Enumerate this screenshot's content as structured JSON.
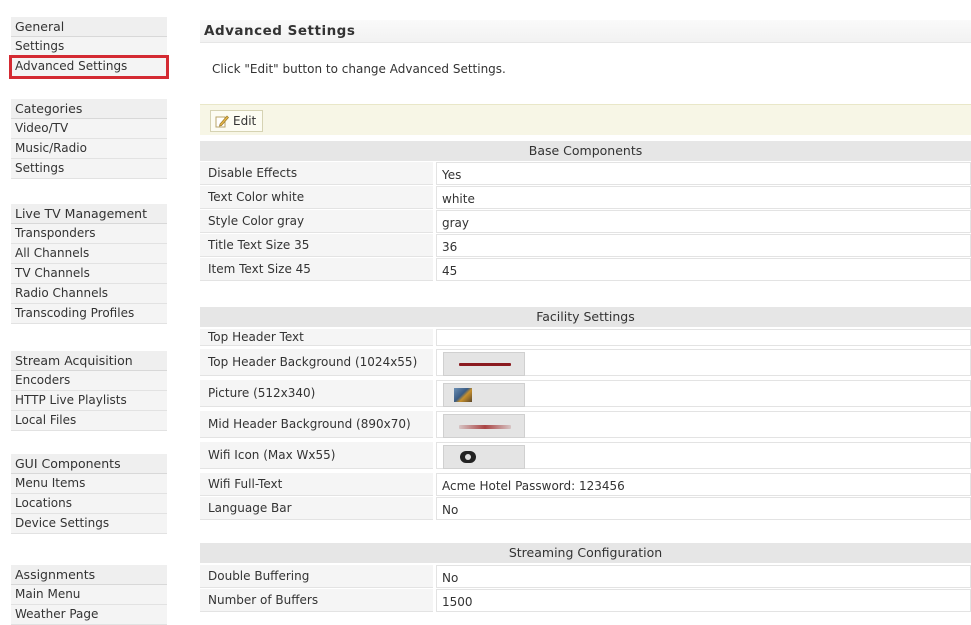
{
  "sidebar": {
    "groups": [
      {
        "title": "General",
        "items": [
          "Settings",
          "Advanced Settings"
        ]
      },
      {
        "title": "Categories",
        "items": [
          "Video/TV",
          "Music/Radio",
          "Settings"
        ]
      },
      {
        "title": "Live TV Management",
        "items": [
          "Transponders",
          "All Channels",
          "TV Channels",
          "Radio Channels",
          "Transcoding Profiles"
        ]
      },
      {
        "title": "Stream Acquisition",
        "items": [
          "Encoders",
          "HTTP Live Playlists",
          "Local Files"
        ]
      },
      {
        "title": "GUI Components",
        "items": [
          "Menu Items",
          "Locations",
          "Device Settings"
        ]
      },
      {
        "title": "Assignments",
        "items": [
          "Main Menu",
          "Weather Page"
        ]
      }
    ],
    "active_item": "Advanced Settings"
  },
  "main": {
    "title": "Advanced Settings",
    "intro": "Click \"Edit\" button to change Advanced Settings.",
    "edit_label": "Edit",
    "sections": {
      "base": {
        "title": "Base Components",
        "rows": [
          {
            "label": "Disable Effects",
            "value": "Yes"
          },
          {
            "label": "Text Color white",
            "value": "white"
          },
          {
            "label": "Style Color gray",
            "value": "gray"
          },
          {
            "label": "Title Text Size 35",
            "value": "36"
          },
          {
            "label": "Item Text Size 45",
            "value": "45"
          }
        ]
      },
      "facility": {
        "title": "Facility Settings",
        "rows": [
          {
            "label": "Top Header Text",
            "value": ""
          },
          {
            "label": "Top Header Background (1024x55)",
            "value": ""
          },
          {
            "label": "Picture (512x340)",
            "value": ""
          },
          {
            "label": "Mid Header Background (890x70)",
            "value": ""
          },
          {
            "label": "Wifi Icon (Max Wx55)",
            "value": ""
          },
          {
            "label": "Wifi Full-Text",
            "value": "Acme Hotel Password: 123456"
          },
          {
            "label": "Language Bar",
            "value": "No"
          }
        ]
      },
      "streaming": {
        "title": "Streaming Configuration",
        "rows": [
          {
            "label": "Double Buffering",
            "value": "No"
          },
          {
            "label": "Number of Buffers",
            "value": "1500"
          }
        ]
      }
    }
  },
  "colors": {
    "active_outline": "#d42a32",
    "toolbar_bg": "#f7f6e6",
    "section_bg": "#e6e6e6",
    "header_bar": "#8b1a1f"
  },
  "icons": {
    "edit": "pencil-icon",
    "picture": "image-thumbnail",
    "wifi": "wifi-icon"
  }
}
